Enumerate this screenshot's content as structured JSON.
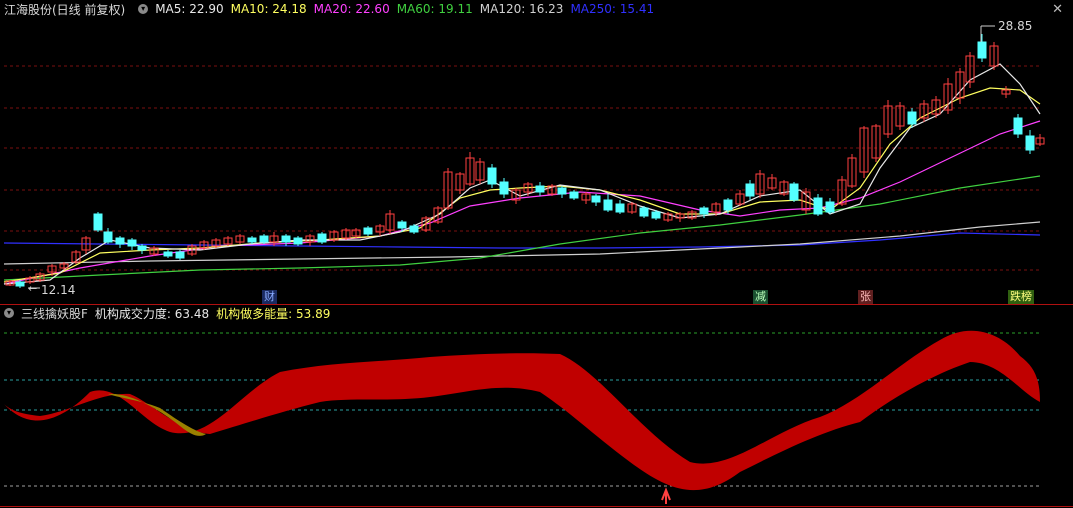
{
  "header": {
    "stock_name": "江海股份(日线 前复权)",
    "ma": [
      {
        "label": "MA5: 22.90",
        "color": "#e8e8e8"
      },
      {
        "label": "MA10: 24.18",
        "color": "#ffff60"
      },
      {
        "label": "MA20: 22.60",
        "color": "#ff40ff"
      },
      {
        "label": "MA60: 19.11",
        "color": "#40d040"
      },
      {
        "label": "MA120: 16.23",
        "color": "#d0d0d0"
      },
      {
        "label": "MA250: 15.41",
        "color": "#3030ff"
      }
    ]
  },
  "close_icon": "close-icon",
  "price_labels": {
    "high": "28.85",
    "low": "12.14"
  },
  "events": [
    {
      "text": "财",
      "bg": "#1a2a60",
      "color": "#88aaff"
    },
    {
      "text": "减",
      "bg": "#1a5030",
      "color": "#bbffbb"
    },
    {
      "text": "张",
      "bg": "#602020",
      "color": "#ffbbbb"
    },
    {
      "text": "跌榜",
      "bg": "#306010",
      "color": "#ffff80"
    }
  ],
  "indicator": {
    "name": "三线擒妖股F",
    "items": [
      {
        "label": "机构成交力度: 63.48",
        "color": "#e8e8e8"
      },
      {
        "label": "机构做多能量: 53.89",
        "color": "#ffff60"
      }
    ]
  },
  "colors": {
    "up": "#ff4040",
    "down": "#54ffff",
    "grid": "#7a1010",
    "band_up": "#c00000",
    "band_down": "#9a8000"
  }
}
